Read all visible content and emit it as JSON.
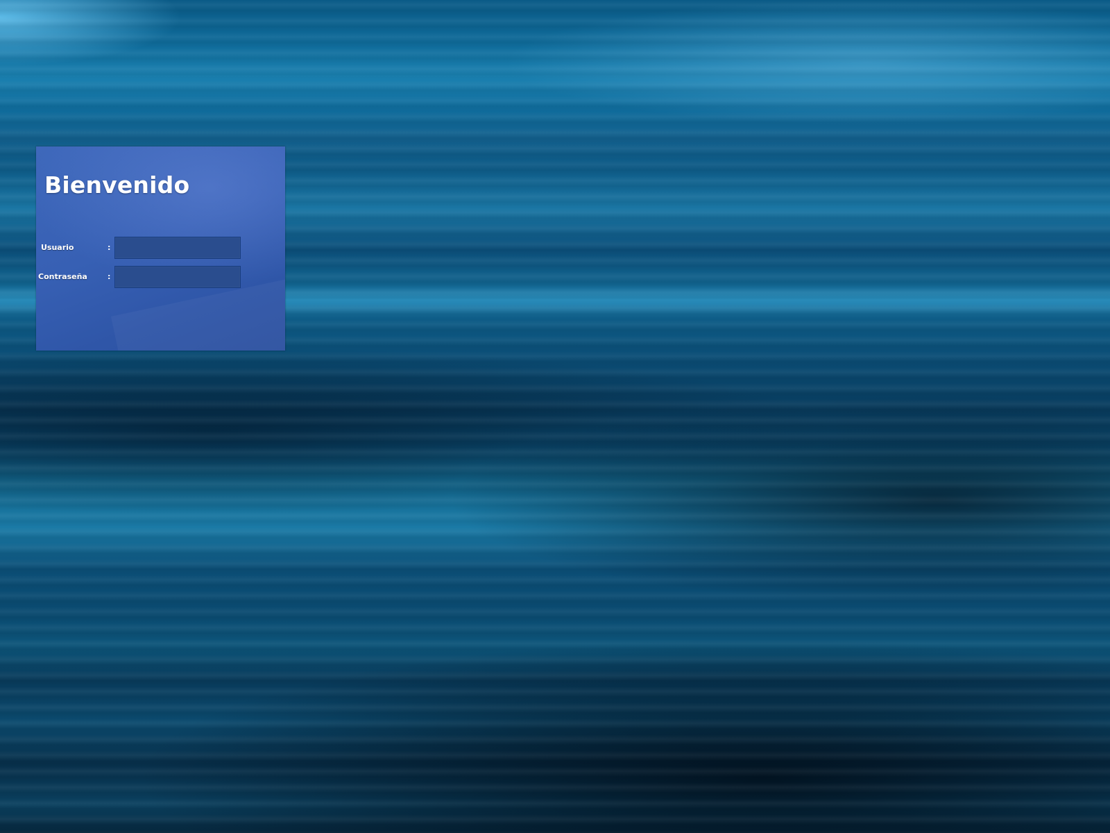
{
  "login": {
    "title": "Bienvenido",
    "username_label": "Usuario",
    "password_label": "Contraseña",
    "separator": ":",
    "username_value": "",
    "password_value": ""
  },
  "colors": {
    "background": "#0b4a6f",
    "panel": "#3760b4",
    "input": "#2a4d8e"
  }
}
